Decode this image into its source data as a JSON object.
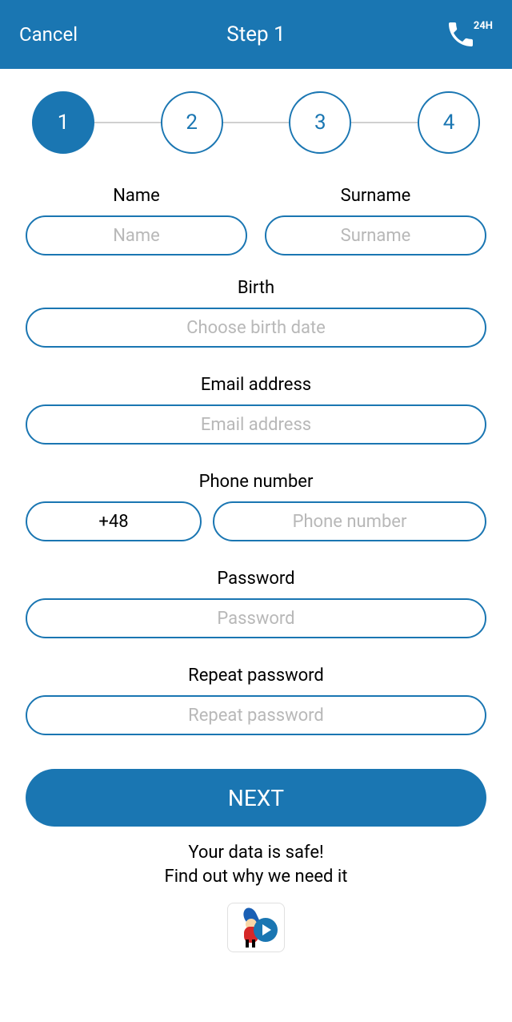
{
  "header": {
    "cancel": "Cancel",
    "title": "Step 1",
    "phone_badge": "24H"
  },
  "stepper": {
    "steps": [
      "1",
      "2",
      "3",
      "4"
    ],
    "active": 0
  },
  "form": {
    "name": {
      "label": "Name",
      "placeholder": "Name",
      "value": ""
    },
    "surname": {
      "label": "Surname",
      "placeholder": "Surname",
      "value": ""
    },
    "birth": {
      "label": "Birth",
      "placeholder": "Choose birth date",
      "value": ""
    },
    "email": {
      "label": "Email address",
      "placeholder": "Email address",
      "value": ""
    },
    "phone": {
      "label": "Phone number",
      "prefix": "+48",
      "placeholder": "Phone number",
      "value": ""
    },
    "password": {
      "label": "Password",
      "placeholder": "Password",
      "value": ""
    },
    "repeat_password": {
      "label": "Repeat password",
      "placeholder": "Repeat password",
      "value": ""
    }
  },
  "next_button": "NEXT",
  "footer": {
    "line1": "Your data is safe!",
    "line2": "Find out why we need it"
  },
  "colors": {
    "primary": "#1a76b2",
    "placeholder": "#b8b8b8"
  }
}
